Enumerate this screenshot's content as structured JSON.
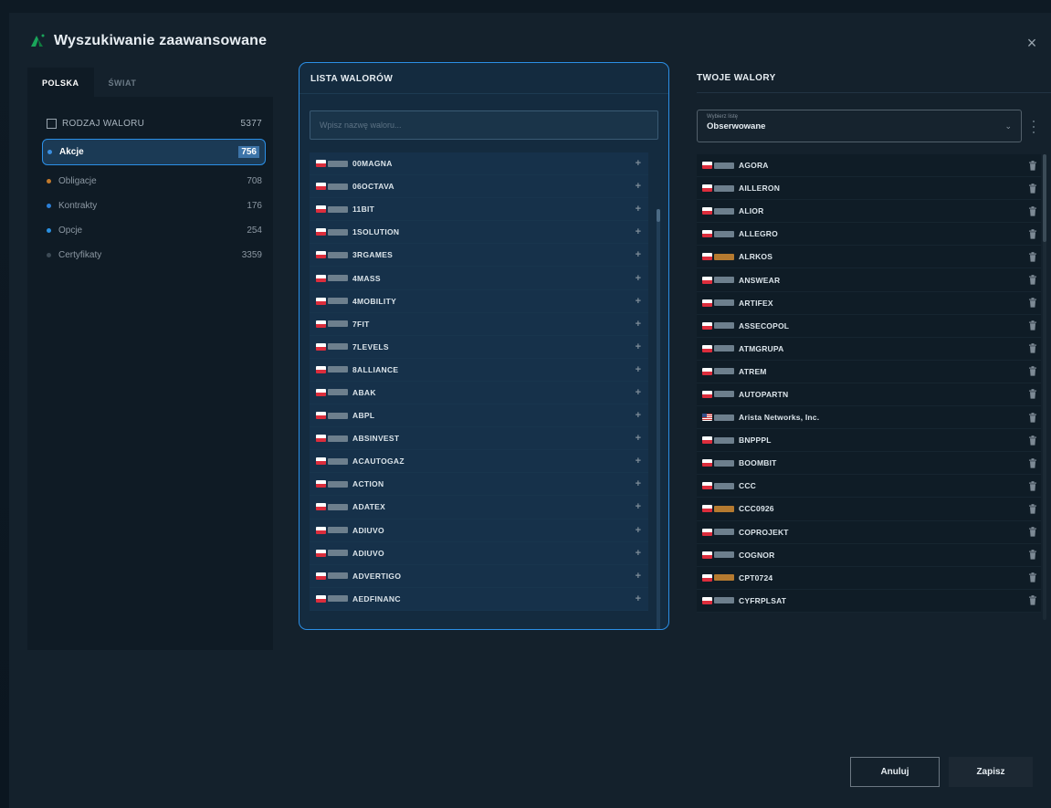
{
  "modal": {
    "title": "Wyszukiwanie zaawansowane",
    "close_icon": "×"
  },
  "left": {
    "tabs": [
      {
        "label": "POLSKA",
        "active": true
      },
      {
        "label": "ŚWIAT",
        "active": false
      }
    ],
    "type_header": {
      "label": "RODZAJ WALORU",
      "count": "5377"
    },
    "categories": [
      {
        "label": "Akcje",
        "count": "756",
        "color": "#3b8fe0",
        "active": true
      },
      {
        "label": "Obligacje",
        "count": "708",
        "color": "#c27a2c",
        "active": false
      },
      {
        "label": "Kontrakty",
        "count": "176",
        "color": "#2c7fd6",
        "active": false
      },
      {
        "label": "Opcje",
        "count": "254",
        "color": "#2a8fe0",
        "active": false
      },
      {
        "label": "Certyfikaty",
        "count": "3359",
        "color": "#3c4a55",
        "active": false
      }
    ]
  },
  "middle": {
    "header": "LISTA WALORÓW",
    "search_placeholder": "Wpisz nazwę waloru...",
    "add_icon": "+",
    "items": [
      {
        "name": "00MAGNA",
        "flag": "pl",
        "badge": "grey"
      },
      {
        "name": "06OCTAVA",
        "flag": "pl",
        "badge": "grey"
      },
      {
        "name": "11BIT",
        "flag": "pl",
        "badge": "grey"
      },
      {
        "name": "1SOLUTION",
        "flag": "pl",
        "badge": "grey"
      },
      {
        "name": "3RGAMES",
        "flag": "pl",
        "badge": "grey"
      },
      {
        "name": "4MASS",
        "flag": "pl",
        "badge": "grey"
      },
      {
        "name": "4MOBILITY",
        "flag": "pl",
        "badge": "grey"
      },
      {
        "name": "7FIT",
        "flag": "pl",
        "badge": "grey"
      },
      {
        "name": "7LEVELS",
        "flag": "pl",
        "badge": "grey"
      },
      {
        "name": "8ALLIANCE",
        "flag": "pl",
        "badge": "grey"
      },
      {
        "name": "ABAK",
        "flag": "pl",
        "badge": "grey"
      },
      {
        "name": "ABPL",
        "flag": "pl",
        "badge": "grey"
      },
      {
        "name": "ABSINVEST",
        "flag": "pl",
        "badge": "grey"
      },
      {
        "name": "ACAUTOGAZ",
        "flag": "pl",
        "badge": "grey"
      },
      {
        "name": "ACTION",
        "flag": "pl",
        "badge": "grey"
      },
      {
        "name": "ADATEX",
        "flag": "pl",
        "badge": "grey"
      },
      {
        "name": "ADIUVO",
        "flag": "pl",
        "badge": "grey"
      },
      {
        "name": "ADIUVO",
        "flag": "pl",
        "badge": "grey"
      },
      {
        "name": "ADVERTIGO",
        "flag": "pl",
        "badge": "grey"
      },
      {
        "name": "AEDFINANC",
        "flag": "pl",
        "badge": "grey"
      }
    ]
  },
  "right": {
    "header": "TWOJE WALORY",
    "select_label": "Wybierz listę",
    "select_value": "Obserwowane",
    "chevron_icon": "⌄",
    "items": [
      {
        "name": "AGORA",
        "flag": "pl",
        "badge": "grey"
      },
      {
        "name": "AILLERON",
        "flag": "pl",
        "badge": "grey"
      },
      {
        "name": "ALIOR",
        "flag": "pl",
        "badge": "grey"
      },
      {
        "name": "ALLEGRO",
        "flag": "pl",
        "badge": "grey"
      },
      {
        "name": "ALRKOS",
        "flag": "pl",
        "badge": "orange"
      },
      {
        "name": "ANSWEAR",
        "flag": "pl",
        "badge": "grey"
      },
      {
        "name": "ARTIFEX",
        "flag": "pl",
        "badge": "grey"
      },
      {
        "name": "ASSECOPOL",
        "flag": "pl",
        "badge": "grey"
      },
      {
        "name": "ATMGRUPA",
        "flag": "pl",
        "badge": "grey"
      },
      {
        "name": "ATREM",
        "flag": "pl",
        "badge": "grey"
      },
      {
        "name": "AUTOPARTN",
        "flag": "pl",
        "badge": "grey"
      },
      {
        "name": "Arista Networks, Inc.",
        "flag": "us",
        "badge": "grey"
      },
      {
        "name": "BNPPPL",
        "flag": "pl",
        "badge": "grey"
      },
      {
        "name": "BOOMBIT",
        "flag": "pl",
        "badge": "grey"
      },
      {
        "name": "CCC",
        "flag": "pl",
        "badge": "grey"
      },
      {
        "name": "CCC0926",
        "flag": "pl",
        "badge": "orange"
      },
      {
        "name": "COPROJEKT",
        "flag": "pl",
        "badge": "grey"
      },
      {
        "name": "COGNOR",
        "flag": "pl",
        "badge": "grey"
      },
      {
        "name": "CPT0724",
        "flag": "pl",
        "badge": "orange"
      },
      {
        "name": "CYFRPLSAT",
        "flag": "pl",
        "badge": "grey"
      }
    ]
  },
  "footer": {
    "cancel_label": "Anuluj",
    "save_label": "Zapisz"
  },
  "colors": {
    "accent": "#2b8fe6",
    "background": "#14212c"
  }
}
